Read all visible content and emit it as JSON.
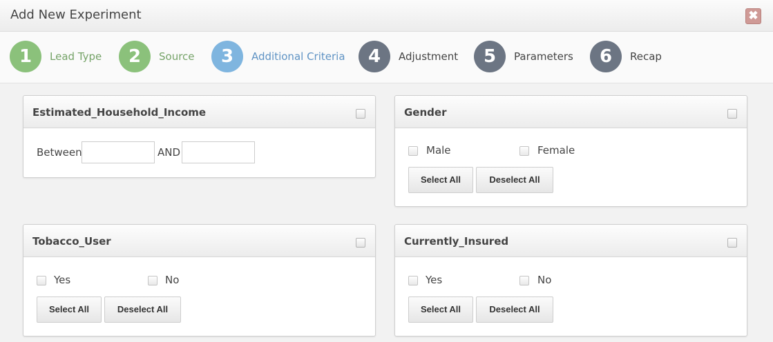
{
  "modal": {
    "title": "Add New Experiment",
    "close_glyph": "✖"
  },
  "wizard": {
    "steps": [
      {
        "number": "1",
        "label": "Lead Type",
        "state": "done"
      },
      {
        "number": "2",
        "label": "Source",
        "state": "done"
      },
      {
        "number": "3",
        "label": "Additional Criteria",
        "state": "active"
      },
      {
        "number": "4",
        "label": "Adjustment",
        "state": "todo"
      },
      {
        "number": "5",
        "label": "Parameters",
        "state": "todo"
      },
      {
        "number": "6",
        "label": "Recap",
        "state": "todo"
      }
    ]
  },
  "colors": {
    "step_done": "#8bc17b",
    "step_active": "#7fb5df",
    "step_todo": "#6c7583",
    "close_button": "#cf9a96"
  },
  "panels": {
    "income": {
      "title": "Estimated_Household_Income",
      "between_label": "Between",
      "and_label": "AND",
      "min_value": "",
      "max_value": ""
    },
    "gender": {
      "title": "Gender",
      "options": [
        "Male",
        "Female"
      ],
      "select_all": "Select All",
      "deselect_all": "Deselect All"
    },
    "tobacco": {
      "title": "Tobacco_User",
      "options": [
        "Yes",
        "No"
      ],
      "select_all": "Select All",
      "deselect_all": "Deselect All"
    },
    "insured": {
      "title": "Currently_Insured",
      "options": [
        "Yes",
        "No"
      ],
      "select_all": "Select All",
      "deselect_all": "Deselect All"
    }
  }
}
